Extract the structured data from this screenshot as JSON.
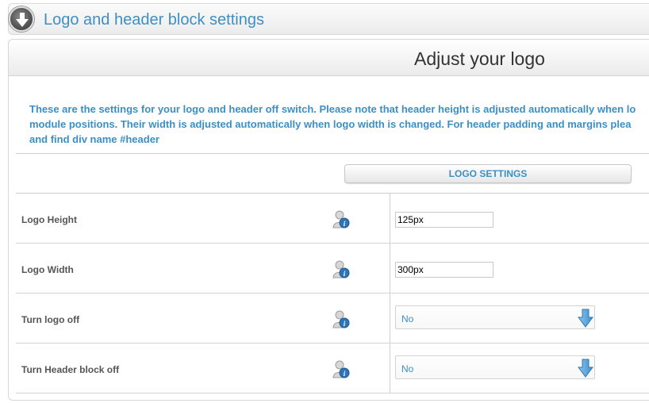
{
  "block": {
    "title": "Logo and header block settings",
    "toggle_icon": "arrow-down-circle-icon"
  },
  "panel": {
    "title": "Adjust your logo",
    "intro_lines": [
      "These are the settings for your logo and header off switch. Please note that header height is adjusted automatically when lo",
      "module positions. Their width is adjusted automatically when logo width is changed. For header padding and margins plea",
      "and find div name #header"
    ],
    "section_label": "LOGO SETTINGS"
  },
  "settings": [
    {
      "label": "Logo Height",
      "type": "text",
      "value": "125px",
      "icon": "info-icon"
    },
    {
      "label": "Logo Width",
      "type": "text",
      "value": "300px",
      "icon": "info-icon"
    },
    {
      "label": "Turn logo off",
      "type": "select",
      "value": "No",
      "icon": "info-icon"
    },
    {
      "label": "Turn Header block off",
      "type": "select",
      "value": "No",
      "icon": "info-icon"
    }
  ],
  "colors": {
    "accent": "#3b8fc4",
    "title_blue": "#3f8fc4",
    "label_gray": "#555555"
  }
}
